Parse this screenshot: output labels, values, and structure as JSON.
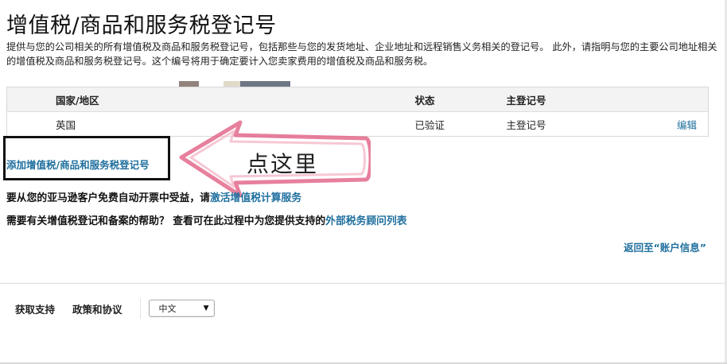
{
  "page": {
    "title": "增值税/商品和服务税登记号",
    "description": "提供与您的公司相关的所有增值税及商品和服务税登记号，包括那些与您的发货地址、企业地址和远程销售义务相关的登记号。 此外，请指明与您的主要公司地址相关的增值税及商品和服务税登记号。这个编号将用于确定要计入您卖家费用的增值税及商品和服务税。"
  },
  "table": {
    "headers": {
      "country": "国家/地区",
      "status": "状态",
      "primary": "主登记号"
    },
    "rows": [
      {
        "country": "英国",
        "status": "已验证",
        "primary": "主登记号",
        "action": "编辑"
      }
    ]
  },
  "add_link": "添加增值税/商品和服务税登记号",
  "annotation": {
    "text": "点这里",
    "colors": {
      "arrow": "#e36a8c",
      "box": "#111111"
    }
  },
  "invoice_notice": {
    "prefix": "要从您的亚马逊客户免费自动开票中受益，请",
    "link": "激活增值税计算服务"
  },
  "help_notice": {
    "prefix": "需要有关增值税登记和备案的帮助？ 查看可在此过程中为您提供支持的",
    "link": "外部税务顾问列表"
  },
  "back_link": "返回至“账户信息”",
  "footer": {
    "support": "获取支持",
    "policies": "政策和协议",
    "language": {
      "selected": "中文",
      "icon": "dropdown-triangle-icon"
    }
  },
  "colors": {
    "link": "#1f6f9e",
    "verified": "#3f8f16",
    "header_bg": "#f3f3f3"
  }
}
